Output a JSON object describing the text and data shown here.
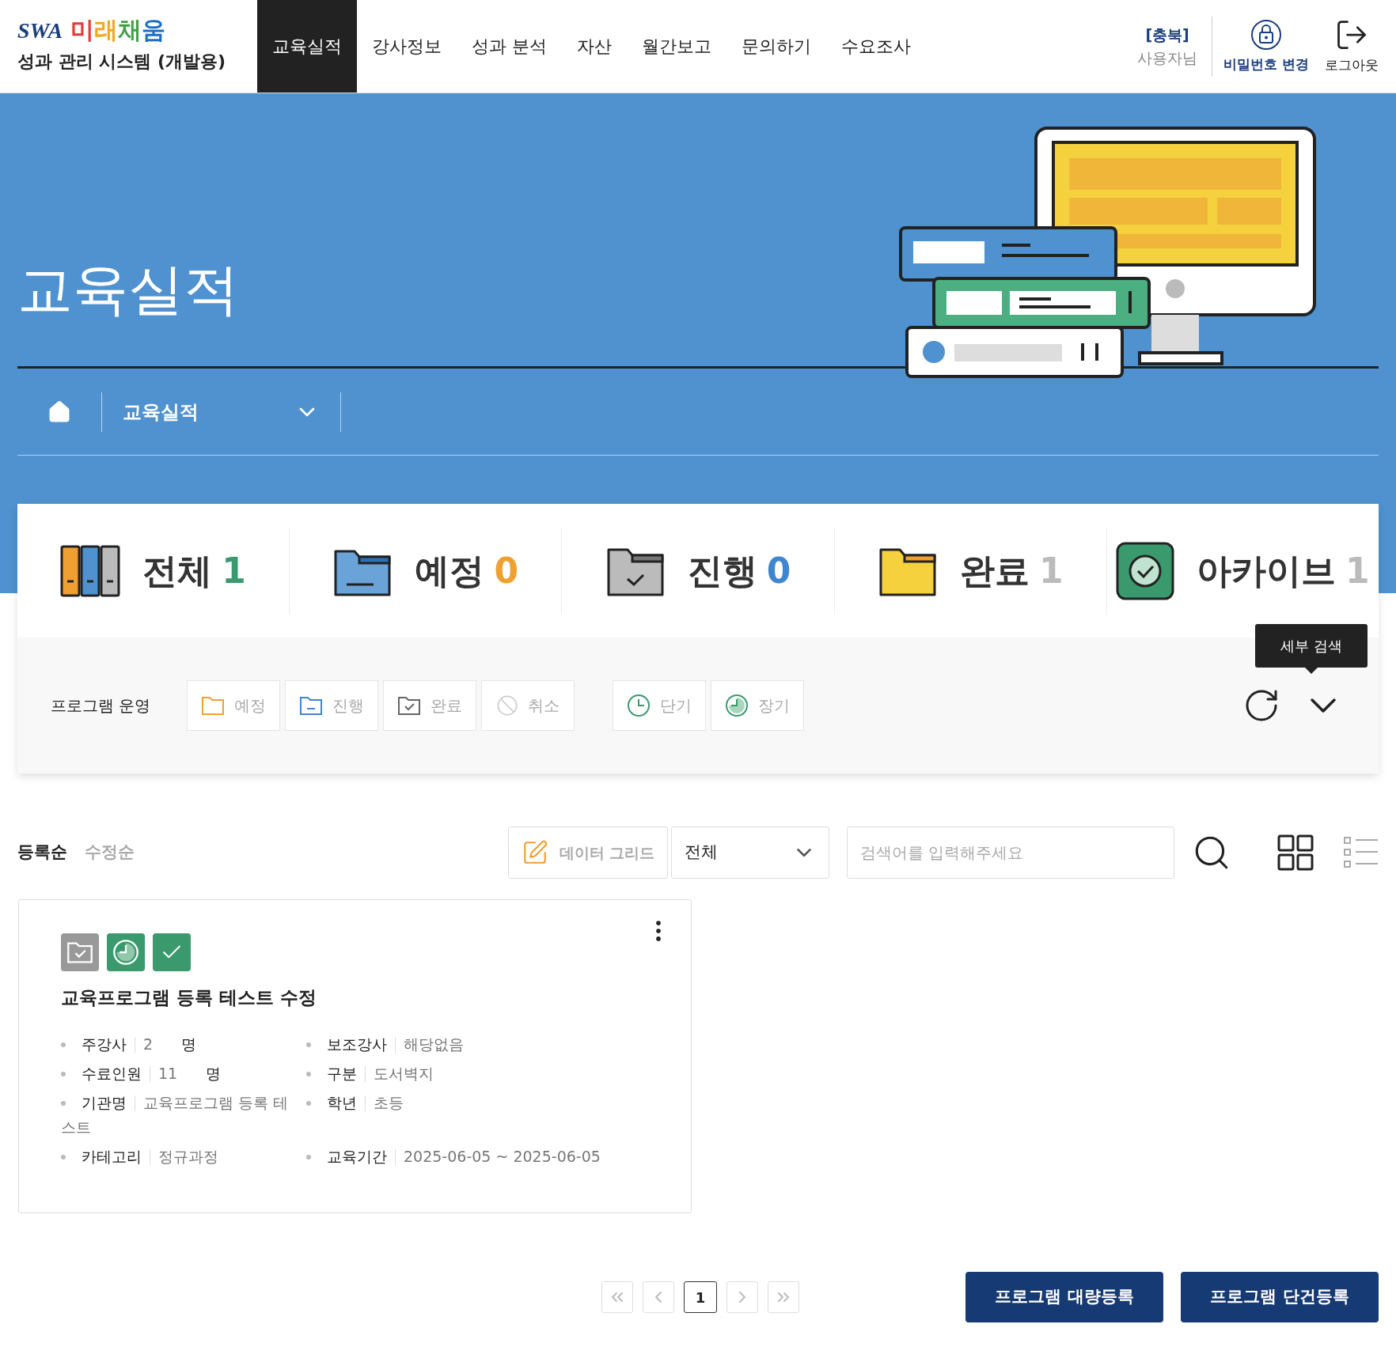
{
  "logo": {
    "mark": "SWA",
    "name": "미래채움",
    "subtitle": "성과 관리 시스템 (개발용)"
  },
  "nav": [
    {
      "label": "교육실적",
      "selected": true
    },
    {
      "label": "강사정보",
      "selected": false
    },
    {
      "label": "성과 분석",
      "selected": false
    },
    {
      "label": "자산",
      "selected": false
    },
    {
      "label": "월간보고",
      "selected": false
    },
    {
      "label": "문의하기",
      "selected": false
    },
    {
      "label": "수요조사",
      "selected": false
    }
  ],
  "user": {
    "region": "[충북]",
    "name": "사용자님",
    "password_change": "비밀번호 변경",
    "logout": "로그아웃"
  },
  "banner": {
    "title": "교육실적",
    "breadcrumb": "교육실적"
  },
  "stats": [
    {
      "kind": "all",
      "label": "전체",
      "count": "1",
      "color": "#3a9a6e"
    },
    {
      "kind": "planned",
      "label": "예정",
      "count": "0",
      "color": "#f0a030"
    },
    {
      "kind": "ongoing",
      "label": "진행",
      "count": "0",
      "color": "#3f86d0"
    },
    {
      "kind": "done",
      "label": "완료",
      "count": "1",
      "color": "#bbbbbb"
    },
    {
      "kind": "archive",
      "label": "아카이브",
      "count": "1",
      "color": "#bbbbbb"
    }
  ],
  "filter": {
    "label": "프로그램 운영",
    "tooltip": "세부 검색",
    "status_chips": [
      {
        "kind": "planned",
        "label": "예정",
        "selected": false
      },
      {
        "kind": "ongoing",
        "label": "진행",
        "selected": false
      },
      {
        "kind": "done",
        "label": "완료",
        "selected": false
      },
      {
        "kind": "cancel",
        "label": "취소",
        "selected": false
      }
    ],
    "term_chips": [
      {
        "kind": "short",
        "label": "단기",
        "selected": false
      },
      {
        "kind": "long",
        "label": "장기",
        "selected": false
      }
    ]
  },
  "sort": [
    {
      "label": "등록순",
      "selected": true
    },
    {
      "label": "수정순",
      "selected": false
    }
  ],
  "toolbar": {
    "grid_button": "데이터 그리드",
    "category": "전체",
    "search_placeholder": "검색어를 입력해주세요",
    "views": [
      {
        "kind": "grid",
        "selected": true
      },
      {
        "kind": "list",
        "selected": false
      }
    ]
  },
  "cards": [
    {
      "badges": [
        {
          "kind": "done"
        },
        {
          "kind": "long"
        },
        {
          "kind": "check"
        }
      ],
      "title": "교육프로그램 등록 테스트 수정",
      "fields": [
        {
          "label": "주강사",
          "value": "2",
          "unit": "명"
        },
        {
          "label": "보조강사",
          "value": "해당없음"
        },
        {
          "label": "수료인원",
          "value": "11",
          "unit": "명"
        },
        {
          "label": "구분",
          "value": "도서벽지"
        },
        {
          "label": "기관명",
          "value": "교육프로그램 등록 테스트"
        },
        {
          "label": "학년",
          "value": "초등"
        },
        {
          "label": "카테고리",
          "value": "정규과정"
        },
        {
          "label": "교육기간",
          "value": "2025-06-05 ~ 2025-06-05"
        }
      ]
    }
  ],
  "pagination": {
    "pages": [
      {
        "label": "1",
        "selected": true
      }
    ]
  },
  "actions": [
    "프로그램 대량등록",
    "프로그램 단건등록"
  ]
}
